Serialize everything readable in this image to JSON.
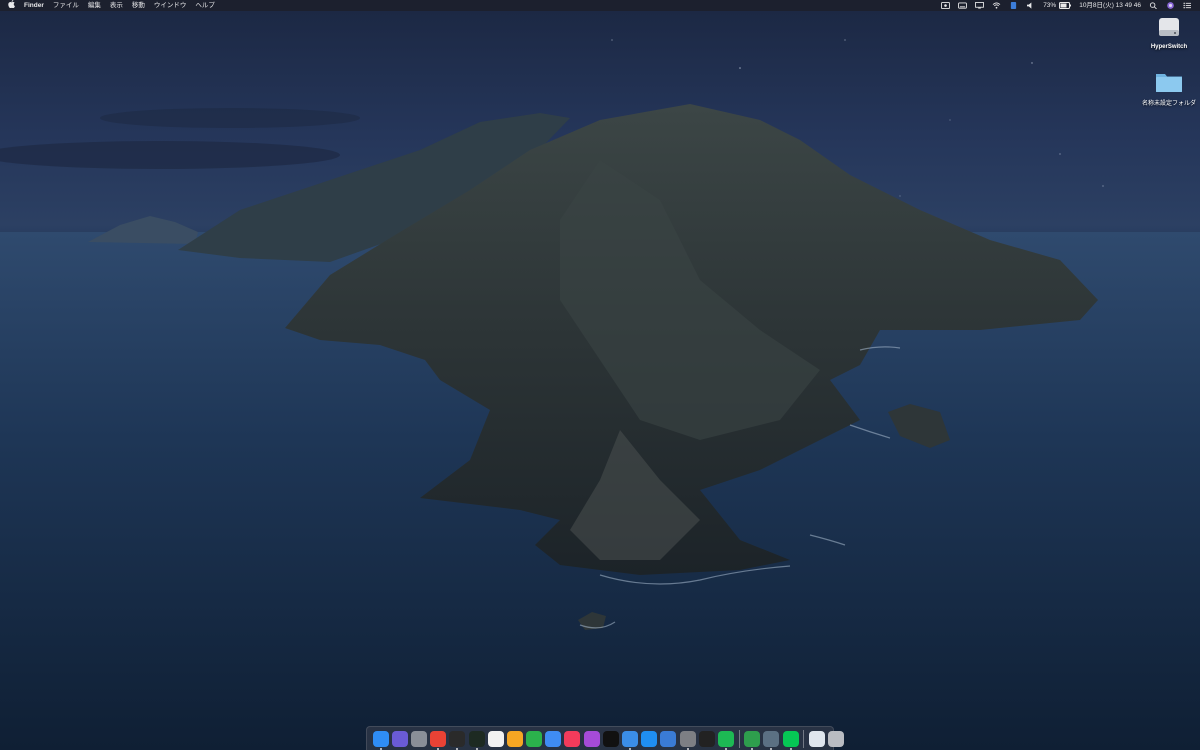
{
  "menubar": {
    "app_name": "Finder",
    "menus": [
      "ファイル",
      "編集",
      "表示",
      "移動",
      "ウインドウ",
      "ヘルプ"
    ],
    "battery": "73%",
    "datetime": "10月8日(火)  13 49 46"
  },
  "desktop_icons": [
    {
      "label": "HyperSwitch",
      "icon": "drive-icon"
    },
    {
      "label": "名称未設定フォルダ",
      "icon": "folder-icon"
    }
  ],
  "dock": {
    "apps": [
      {
        "name": "finder",
        "color": "#2f8df5",
        "running": true
      },
      {
        "name": "siri",
        "color": "#6a5bd6",
        "running": false
      },
      {
        "name": "launchpad",
        "color": "#8a8f98",
        "running": false
      },
      {
        "name": "chrome",
        "color": "#e94235",
        "running": true
      },
      {
        "name": "intellij",
        "color": "#2a2a2a",
        "running": true
      },
      {
        "name": "iterm",
        "color": "#1d2a22",
        "running": true
      },
      {
        "name": "calendar",
        "color": "#f2f2f2",
        "running": false
      },
      {
        "name": "pages",
        "color": "#f5a623",
        "running": false
      },
      {
        "name": "numbers",
        "color": "#2bb24c",
        "running": false
      },
      {
        "name": "keynote",
        "color": "#3f8cf3",
        "running": false
      },
      {
        "name": "music",
        "color": "#f23b5b",
        "running": false
      },
      {
        "name": "podcasts",
        "color": "#a64bd8",
        "running": false
      },
      {
        "name": "apple-tv",
        "color": "#111111",
        "running": false
      },
      {
        "name": "maps",
        "color": "#3b8ee8",
        "running": true
      },
      {
        "name": "app-store",
        "color": "#1f8ef1",
        "running": false
      },
      {
        "name": "xcode-instruments",
        "color": "#3a7bd5",
        "running": false
      },
      {
        "name": "system-preferences",
        "color": "#7d7f84",
        "running": true
      },
      {
        "name": "terminal",
        "color": "#222222",
        "running": false
      },
      {
        "name": "spotify",
        "color": "#1db954",
        "running": true
      }
    ],
    "apps_right": [
      {
        "name": "money-app",
        "color": "#2e9e4d",
        "running": true
      },
      {
        "name": "ticket-app",
        "color": "#5b7083",
        "running": true
      },
      {
        "name": "line",
        "color": "#06c755",
        "running": true
      }
    ],
    "folders": [
      {
        "name": "documents-stack",
        "color": "#dfe6ee"
      },
      {
        "name": "trash",
        "color": "#b9bcc2"
      }
    ]
  }
}
